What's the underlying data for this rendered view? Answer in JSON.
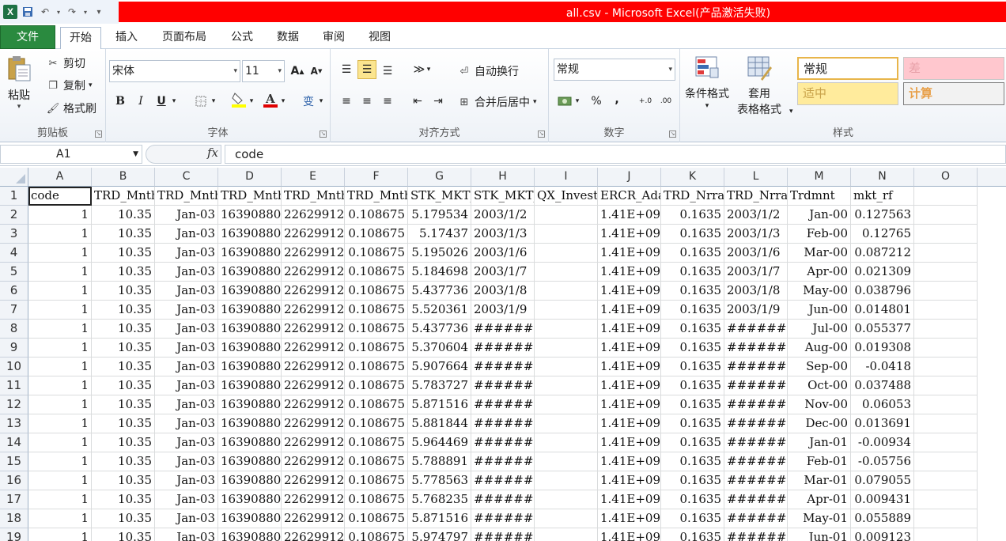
{
  "titlebar": {
    "title": "all.csv - Microsoft Excel(产品激活失败)",
    "app_icon": "excel-icon"
  },
  "tabs": [
    "文件",
    "开始",
    "插入",
    "页面布局",
    "公式",
    "数据",
    "审阅",
    "视图"
  ],
  "ribbon": {
    "clipboard": {
      "label": "剪贴板",
      "paste": "粘贴",
      "cut": "剪切",
      "copy": "复制",
      "format_painter": "格式刷"
    },
    "font": {
      "label": "字体",
      "font_name": "宋体",
      "font_size": "11",
      "grow": "A",
      "shrink": "A",
      "bold": "B",
      "italic": "I",
      "underline": "U",
      "wen": "变"
    },
    "alignment": {
      "label": "对齐方式",
      "wrap": "自动换行",
      "merge": "合并后居中"
    },
    "number": {
      "label": "数字",
      "format": "常规",
      "percent": "%",
      "comma": ","
    },
    "styles": {
      "label": "样式",
      "cond_format": "条件格式",
      "table_format_1": "套用",
      "table_format_2": "表格格式",
      "normal": "常规",
      "bad": "差",
      "neutral": "适中",
      "calc": "计算"
    }
  },
  "formula_bar": {
    "name_box": "A1",
    "fx": "fx",
    "content": "code"
  },
  "columns": [
    "A",
    "B",
    "C",
    "D",
    "E",
    "F",
    "G",
    "H",
    "I",
    "J",
    "K",
    "L",
    "M",
    "N",
    "O"
  ],
  "rows": [
    {
      "n": "1",
      "cells": [
        "code",
        "TRD_Mnth-",
        "TRD_Mnth-",
        "TRD_Mnth-",
        "TRD_Mnth-",
        "TRD_Mnth-",
        "STK_MKT_I",
        "STK_MKT_I",
        "QX_Invest",
        "ERCR_Adaj",
        "TRD_Nrrat",
        "TRD_Nrrat",
        "Trdmnt",
        "mkt_rf",
        ""
      ]
    },
    {
      "n": "2",
      "cells": [
        "1",
        "10.35",
        "Jan-03",
        "16390880",
        "22629912",
        "0.108675",
        "5.179534",
        "2003/1/2",
        "",
        "1.41E+09",
        "0.1635",
        "2003/1/2",
        "Jan-00",
        "0.127563",
        ""
      ]
    },
    {
      "n": "3",
      "cells": [
        "1",
        "10.35",
        "Jan-03",
        "16390880",
        "22629912",
        "0.108675",
        "5.17437",
        "2003/1/3",
        "",
        "1.41E+09",
        "0.1635",
        "2003/1/3",
        "Feb-00",
        "0.12765",
        ""
      ]
    },
    {
      "n": "4",
      "cells": [
        "1",
        "10.35",
        "Jan-03",
        "16390880",
        "22629912",
        "0.108675",
        "5.195026",
        "2003/1/6",
        "",
        "1.41E+09",
        "0.1635",
        "2003/1/6",
        "Mar-00",
        "0.087212",
        ""
      ]
    },
    {
      "n": "5",
      "cells": [
        "1",
        "10.35",
        "Jan-03",
        "16390880",
        "22629912",
        "0.108675",
        "5.184698",
        "2003/1/7",
        "",
        "1.41E+09",
        "0.1635",
        "2003/1/7",
        "Apr-00",
        "0.021309",
        ""
      ]
    },
    {
      "n": "6",
      "cells": [
        "1",
        "10.35",
        "Jan-03",
        "16390880",
        "22629912",
        "0.108675",
        "5.437736",
        "2003/1/8",
        "",
        "1.41E+09",
        "0.1635",
        "2003/1/8",
        "May-00",
        "0.038796",
        ""
      ]
    },
    {
      "n": "7",
      "cells": [
        "1",
        "10.35",
        "Jan-03",
        "16390880",
        "22629912",
        "0.108675",
        "5.520361",
        "2003/1/9",
        "",
        "1.41E+09",
        "0.1635",
        "2003/1/9",
        "Jun-00",
        "0.014801",
        ""
      ]
    },
    {
      "n": "8",
      "cells": [
        "1",
        "10.35",
        "Jan-03",
        "16390880",
        "22629912",
        "0.108675",
        "5.437736",
        "########",
        "",
        "1.41E+09",
        "0.1635",
        "########",
        "Jul-00",
        "0.055377",
        ""
      ]
    },
    {
      "n": "9",
      "cells": [
        "1",
        "10.35",
        "Jan-03",
        "16390880",
        "22629912",
        "0.108675",
        "5.370604",
        "########",
        "",
        "1.41E+09",
        "0.1635",
        "########",
        "Aug-00",
        "0.019308",
        ""
      ]
    },
    {
      "n": "10",
      "cells": [
        "1",
        "10.35",
        "Jan-03",
        "16390880",
        "22629912",
        "0.108675",
        "5.907664",
        "########",
        "",
        "1.41E+09",
        "0.1635",
        "########",
        "Sep-00",
        "-0.0418",
        ""
      ]
    },
    {
      "n": "11",
      "cells": [
        "1",
        "10.35",
        "Jan-03",
        "16390880",
        "22629912",
        "0.108675",
        "5.783727",
        "########",
        "",
        "1.41E+09",
        "0.1635",
        "########",
        "Oct-00",
        "0.037488",
        ""
      ]
    },
    {
      "n": "12",
      "cells": [
        "1",
        "10.35",
        "Jan-03",
        "16390880",
        "22629912",
        "0.108675",
        "5.871516",
        "########",
        "",
        "1.41E+09",
        "0.1635",
        "########",
        "Nov-00",
        "0.06053",
        ""
      ]
    },
    {
      "n": "13",
      "cells": [
        "1",
        "10.35",
        "Jan-03",
        "16390880",
        "22629912",
        "0.108675",
        "5.881844",
        "########",
        "",
        "1.41E+09",
        "0.1635",
        "########",
        "Dec-00",
        "0.013691",
        ""
      ]
    },
    {
      "n": "14",
      "cells": [
        "1",
        "10.35",
        "Jan-03",
        "16390880",
        "22629912",
        "0.108675",
        "5.964469",
        "########",
        "",
        "1.41E+09",
        "0.1635",
        "########",
        "Jan-01",
        "-0.00934",
        ""
      ]
    },
    {
      "n": "15",
      "cells": [
        "1",
        "10.35",
        "Jan-03",
        "16390880",
        "22629912",
        "0.108675",
        "5.788891",
        "########",
        "",
        "1.41E+09",
        "0.1635",
        "########",
        "Feb-01",
        "-0.05756",
        ""
      ]
    },
    {
      "n": "16",
      "cells": [
        "1",
        "10.35",
        "Jan-03",
        "16390880",
        "22629912",
        "0.108675",
        "5.778563",
        "########",
        "",
        "1.41E+09",
        "0.1635",
        "########",
        "Mar-01",
        "0.079055",
        ""
      ]
    },
    {
      "n": "17",
      "cells": [
        "1",
        "10.35",
        "Jan-03",
        "16390880",
        "22629912",
        "0.108675",
        "5.768235",
        "########",
        "",
        "1.41E+09",
        "0.1635",
        "########",
        "Apr-01",
        "0.009431",
        ""
      ]
    },
    {
      "n": "18",
      "cells": [
        "1",
        "10.35",
        "Jan-03",
        "16390880",
        "22629912",
        "0.108675",
        "5.871516",
        "########",
        "",
        "1.41E+09",
        "0.1635",
        "########",
        "May-01",
        "0.055889",
        ""
      ]
    },
    {
      "n": "19",
      "cells": [
        "1",
        "10.35",
        "Jan-03",
        "16390880",
        "22629912",
        "0.108675",
        "5.974797",
        "########",
        "",
        "1.41E+09",
        "0.1635",
        "########",
        "Jun-01",
        "0.009123",
        ""
      ]
    }
  ]
}
